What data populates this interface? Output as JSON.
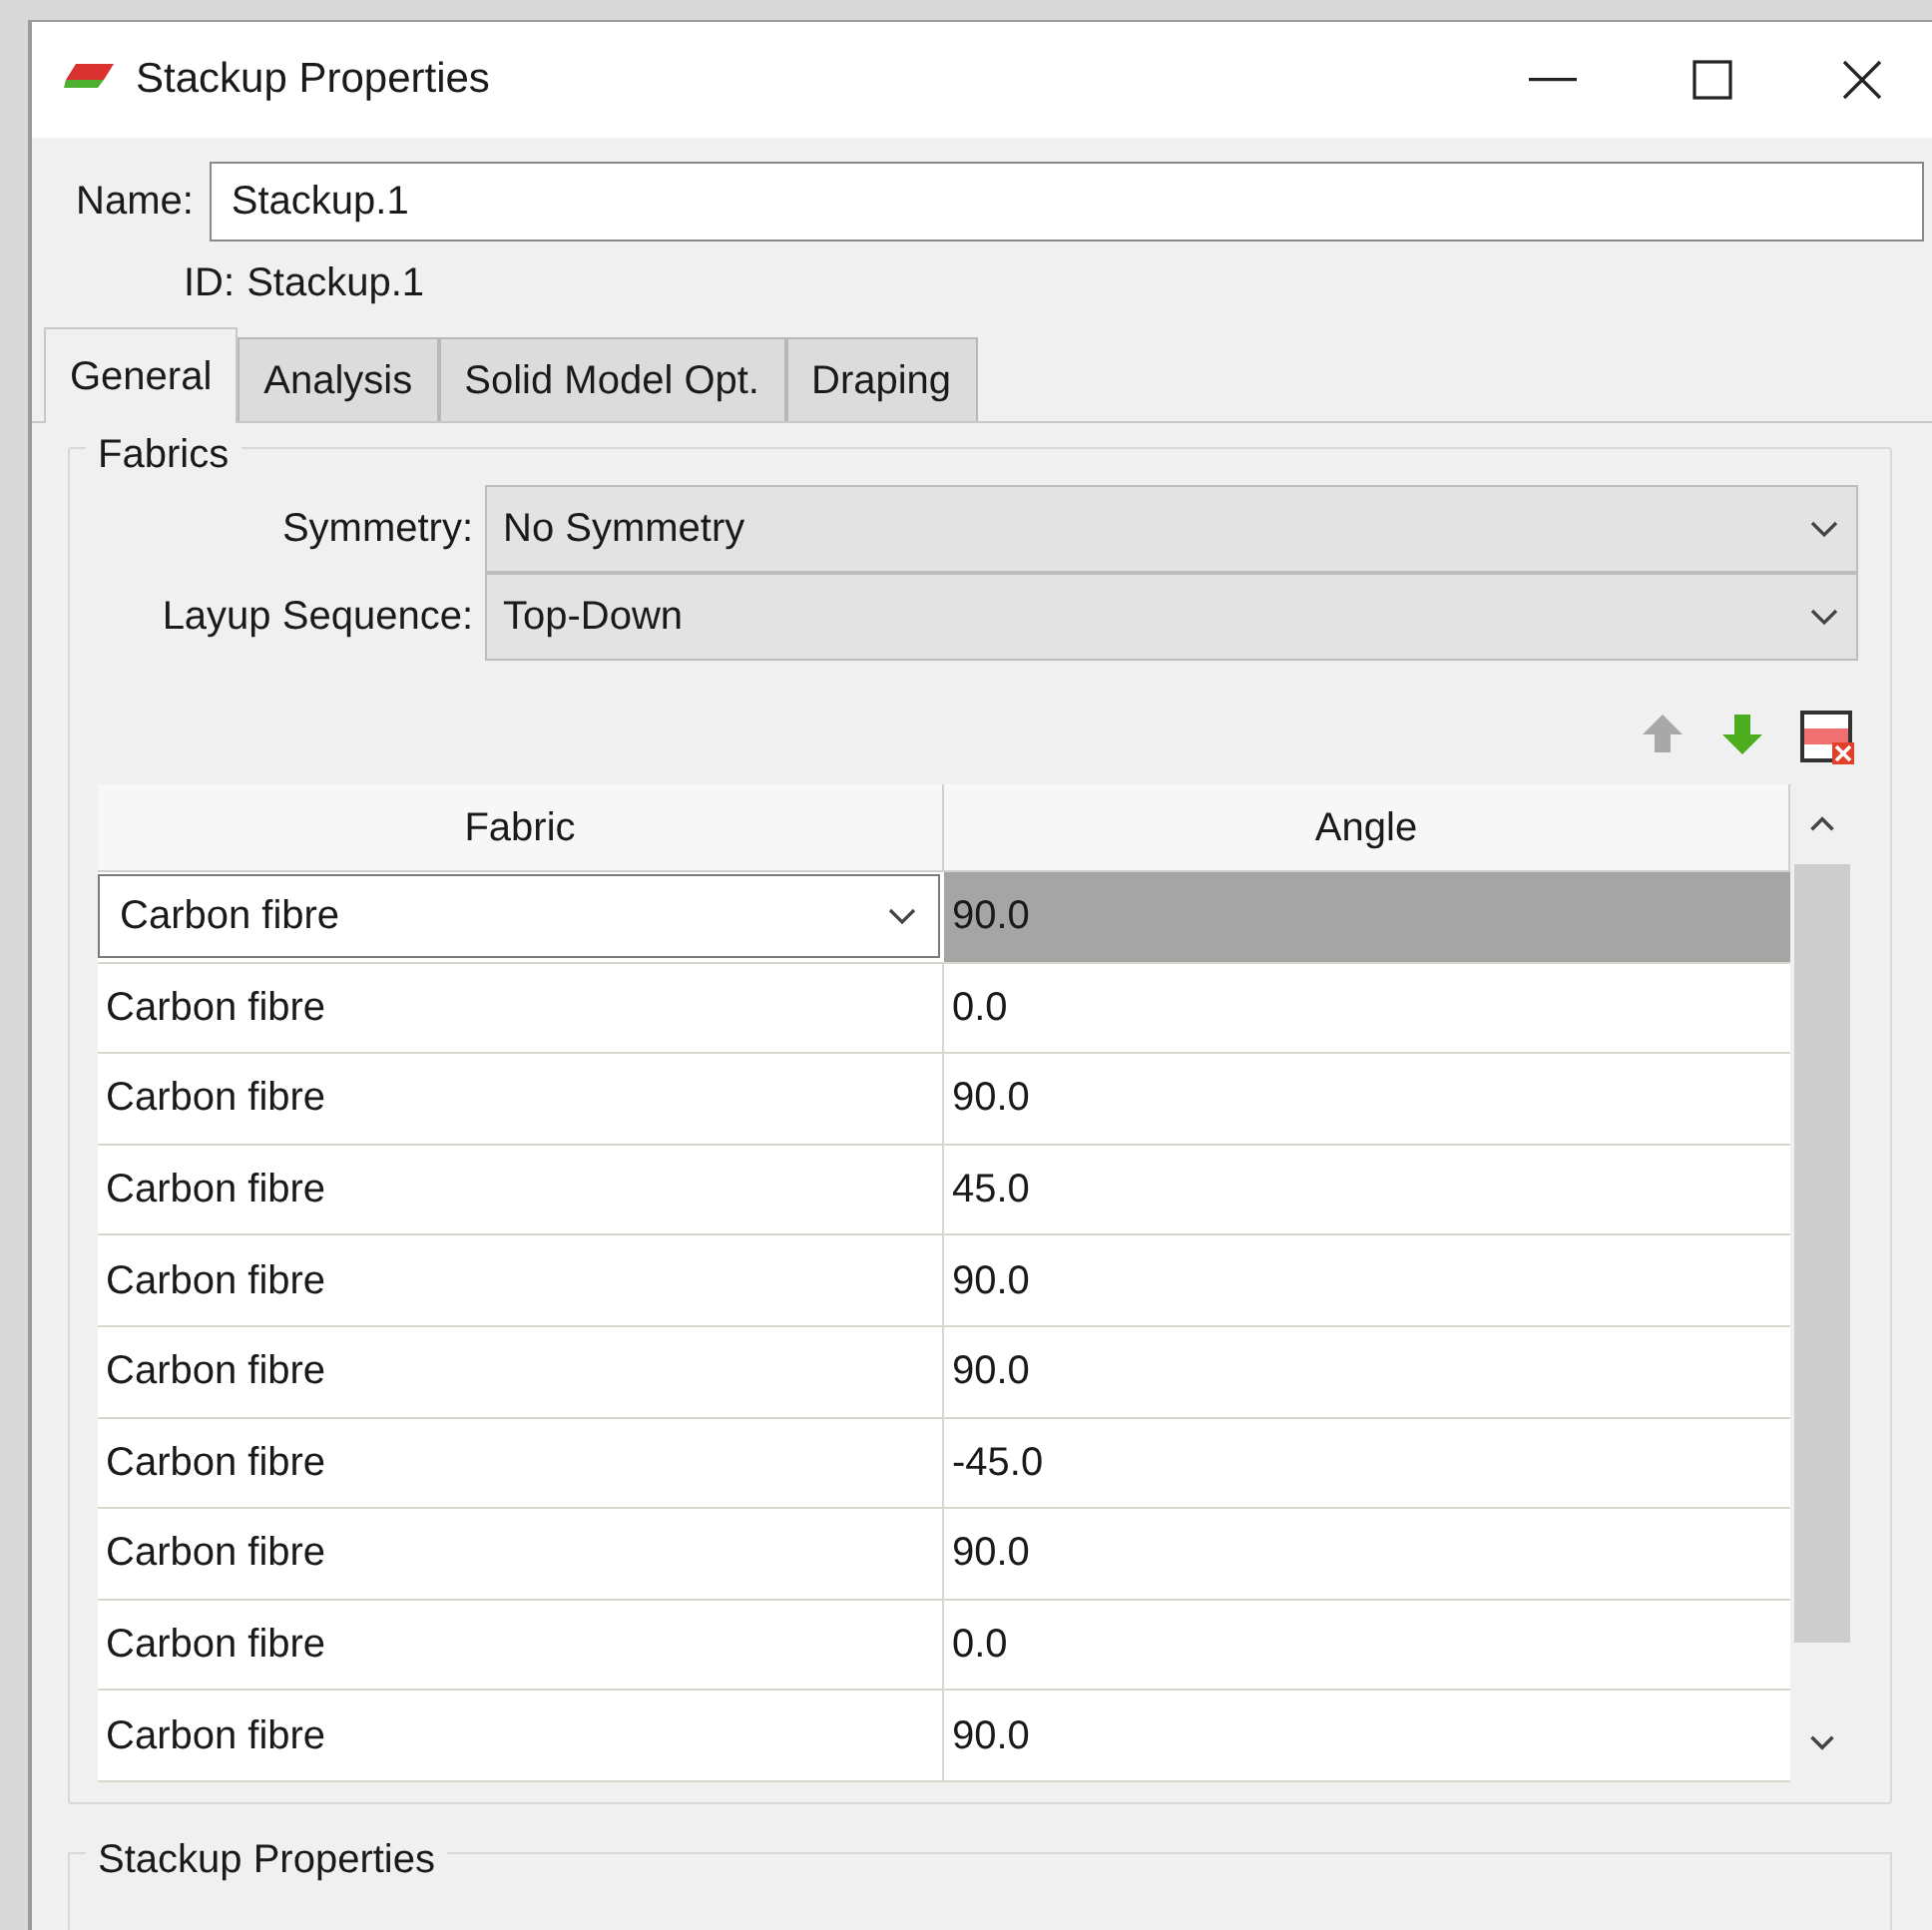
{
  "window": {
    "title": "Stackup Properties"
  },
  "name_field": {
    "label": "Name:",
    "value": "Stackup.1"
  },
  "id_field": {
    "label": "ID:",
    "value": "Stackup.1"
  },
  "tabs": [
    {
      "label": "General",
      "selected": true
    },
    {
      "label": "Analysis",
      "selected": false
    },
    {
      "label": "Solid Model Opt.",
      "selected": false
    },
    {
      "label": "Draping",
      "selected": false
    }
  ],
  "fabrics_group": {
    "title": "Fabrics",
    "symmetry": {
      "label": "Symmetry:",
      "value": "No Symmetry"
    },
    "layup_sequence": {
      "label": "Layup Sequence:",
      "value": "Top-Down"
    },
    "toolbar": [
      {
        "kind": "up",
        "disabled": true
      },
      {
        "kind": "down",
        "disabled": false
      },
      {
        "kind": "delete",
        "disabled": false
      }
    ],
    "table": {
      "columns": [
        "Fabric",
        "Angle"
      ],
      "rows": [
        {
          "fabric": "Carbon fibre",
          "angle": "90.0",
          "selected": true
        },
        {
          "fabric": "Carbon fibre",
          "angle": "0.0",
          "selected": false
        },
        {
          "fabric": "Carbon fibre",
          "angle": "90.0",
          "selected": false
        },
        {
          "fabric": "Carbon fibre",
          "angle": "45.0",
          "selected": false
        },
        {
          "fabric": "Carbon fibre",
          "angle": "90.0",
          "selected": false
        },
        {
          "fabric": "Carbon fibre",
          "angle": "90.0",
          "selected": false
        },
        {
          "fabric": "Carbon fibre",
          "angle": "-45.0",
          "selected": false
        },
        {
          "fabric": "Carbon fibre",
          "angle": "90.0",
          "selected": false
        },
        {
          "fabric": "Carbon fibre",
          "angle": "0.0",
          "selected": false
        },
        {
          "fabric": "Carbon fibre",
          "angle": "90.0",
          "selected": false
        }
      ]
    }
  },
  "stackup_group": {
    "title": "Stackup Properties"
  }
}
